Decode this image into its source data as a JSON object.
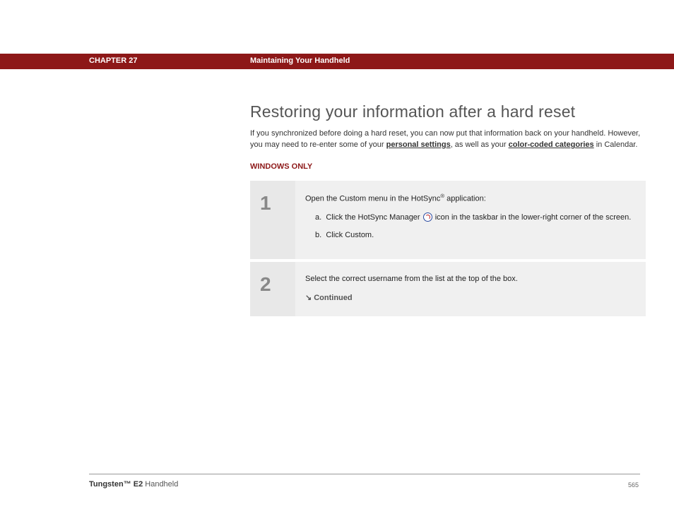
{
  "header": {
    "chapter": "CHAPTER 27",
    "section": "Maintaining Your Handheld"
  },
  "title": "Restoring your information after a hard reset",
  "intro": {
    "pre": "If you synchronized before doing a hard reset, you can now put that information back on your handheld. However, you may need to re-enter some of your ",
    "link1": "personal settings",
    "mid": ", as well as your ",
    "link2": "color-coded categories",
    "post": " in Calendar."
  },
  "platform": "WINDOWS ONLY",
  "steps": [
    {
      "num": "1",
      "main_pre": "Open the Custom menu in the HotSync",
      "main_sup": "®",
      "main_post": " application:",
      "subs": [
        {
          "label": "a.",
          "pre": "Click the HotSync Manager ",
          "post": " icon in the taskbar in the lower-right corner of the screen.",
          "has_icon": true
        },
        {
          "label": "b.",
          "pre": "Click Custom.",
          "post": "",
          "has_icon": false
        }
      ]
    },
    {
      "num": "2",
      "main_pre": "Select the correct username from the list at the top of the box.",
      "main_sup": "",
      "main_post": "",
      "subs": [],
      "continued": "Continued"
    }
  ],
  "footer": {
    "brand": "Tungsten",
    "tm": "™",
    "model": " E2",
    "suffix": " Handheld",
    "page": "565"
  }
}
